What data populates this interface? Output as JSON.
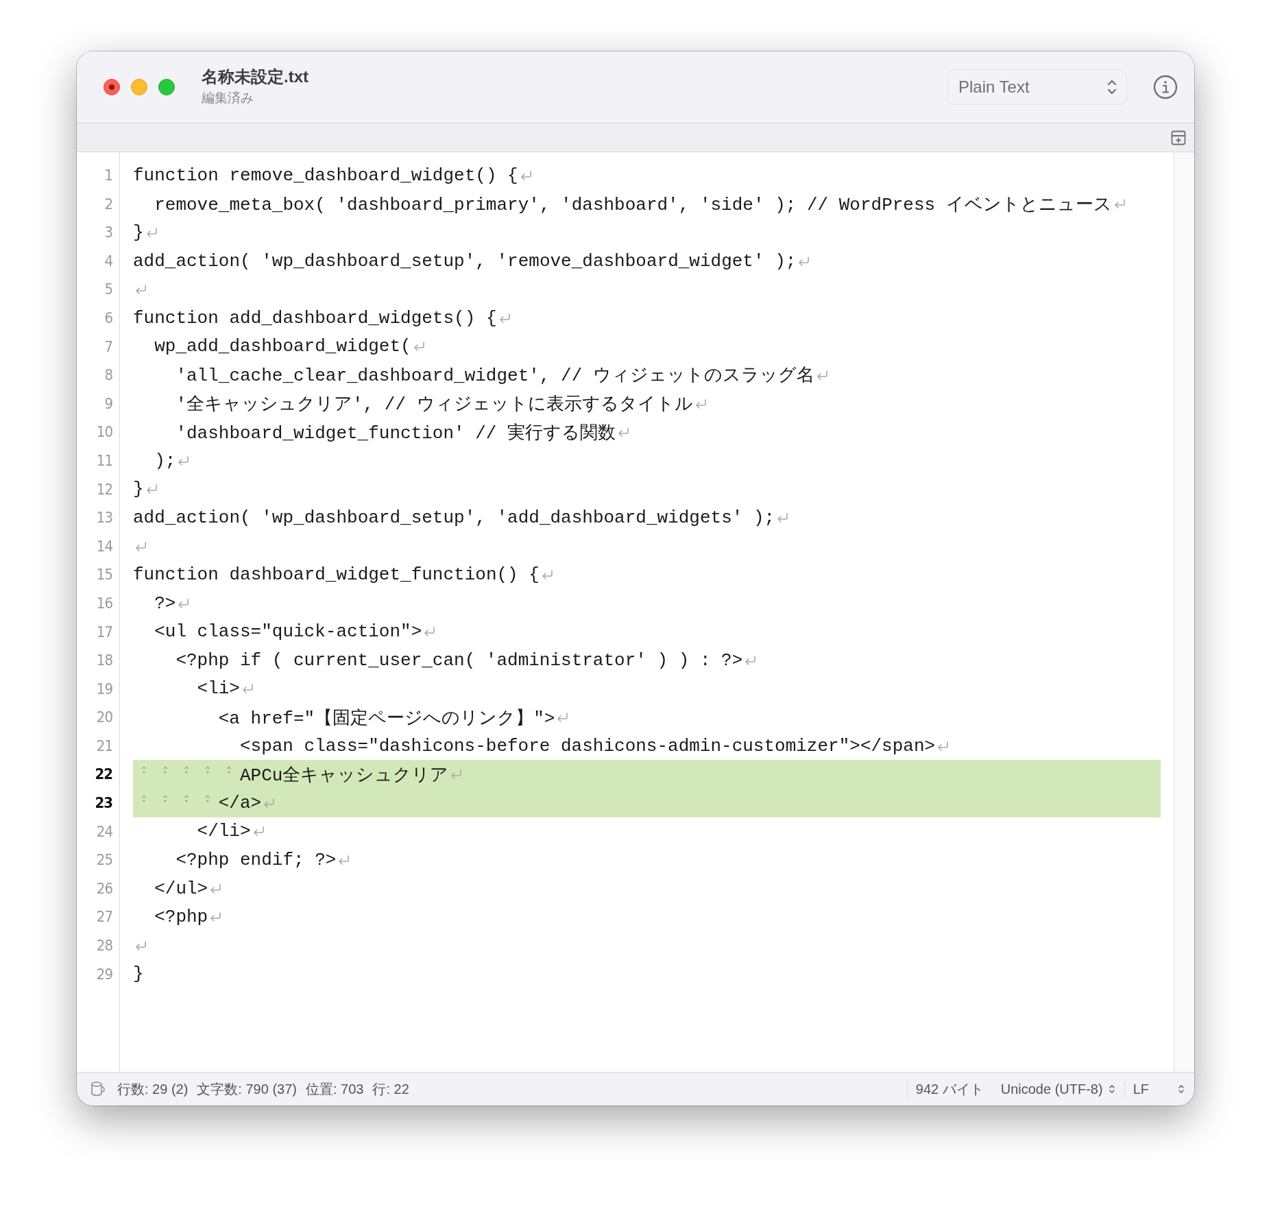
{
  "window": {
    "title": "名称未設定.txt",
    "subtitle": "編集済み"
  },
  "syntax_menu": {
    "value": "Plain Text"
  },
  "lines": [
    {
      "number": "1",
      "text": "function remove_dashboard_widget() {",
      "selected": false,
      "eol": true
    },
    {
      "number": "2",
      "text": "\tremove_meta_box( 'dashboard_primary', 'dashboard', 'side' ); // WordPress イベントとニュース",
      "selected": false,
      "eol": true
    },
    {
      "number": "3",
      "text": "}",
      "selected": false,
      "eol": true
    },
    {
      "number": "4",
      "text": "add_action( 'wp_dashboard_setup', 'remove_dashboard_widget' );",
      "selected": false,
      "eol": true
    },
    {
      "number": "5",
      "selected": false,
      "eol": true
    },
    {
      "number": "6",
      "text": "function add_dashboard_widgets() {",
      "selected": false,
      "eol": true
    },
    {
      "number": "7",
      "text": "\twp_add_dashboard_widget(",
      "selected": false,
      "eol": true
    },
    {
      "number": "8",
      "text": "\t\t'all_cache_clear_dashboard_widget', // ウィジェットのスラッグ名",
      "selected": false,
      "eol": true
    },
    {
      "number": "9",
      "text": "\t\t'全キャッシュクリア', // ウィジェットに表示するタイトル",
      "selected": false,
      "eol": true
    },
    {
      "number": "10",
      "text": "\t\t'dashboard_widget_function' // 実行する関数",
      "selected": false,
      "eol": true
    },
    {
      "number": "11",
      "text": "\t);",
      "selected": false,
      "eol": true
    },
    {
      "number": "12",
      "text": "}",
      "selected": false,
      "eol": true
    },
    {
      "number": "13",
      "text": "add_action( 'wp_dashboard_setup', 'add_dashboard_widgets' );",
      "selected": false,
      "eol": true
    },
    {
      "number": "14",
      "selected": false,
      "eol": true
    },
    {
      "number": "15",
      "text": "function dashboard_widget_function() {",
      "selected": false,
      "eol": true
    },
    {
      "number": "16",
      "text": "\t?>",
      "selected": false,
      "eol": true
    },
    {
      "number": "17",
      "text": "\t<ul class=\"quick-action\">",
      "selected": false,
      "eol": true
    },
    {
      "number": "18",
      "text": "\t\t<?php if ( current_user_can( 'administrator' ) ) : ?>",
      "selected": false,
      "eol": true
    },
    {
      "number": "19",
      "text": "\t\t\t<li>",
      "selected": false,
      "eol": true
    },
    {
      "number": "20",
      "text": "\t\t\t\t<a href=\"【固定ページへのリンク】\">",
      "selected": false,
      "eol": true
    },
    {
      "number": "21",
      "text": "\t\t\t\t\t<span class=\"dashicons-before dashicons-admin-customizer\"></span>",
      "selected": false,
      "eol": true
    },
    {
      "number": "22",
      "text": "\t\t\t\t\tAPCu全キャッシュクリア",
      "selected": true,
      "eol": true
    },
    {
      "number": "23",
      "text": "\t\t\t\t</a>",
      "selected": true,
      "eol": true
    },
    {
      "number": "24",
      "text": "\t\t\t</li>",
      "selected": false,
      "eol": true
    },
    {
      "number": "25",
      "text": "\t\t<?php endif; ?>",
      "selected": false,
      "eol": true
    },
    {
      "number": "26",
      "text": "\t</ul>",
      "selected": false,
      "eol": true
    },
    {
      "number": "27",
      "text": "\t<?php",
      "selected": false,
      "eol": true
    },
    {
      "number": "28",
      "selected": false,
      "eol": true
    },
    {
      "number": "29",
      "text": "}",
      "selected": false,
      "eol": false
    }
  ],
  "status_bar": {
    "left": [
      "行数: 29 (2)",
      "文字数: 790 (37)",
      "位置: 703",
      "行: 22"
    ],
    "right": [
      {
        "text": "942 バイト",
        "kind": "label"
      },
      {
        "text": "Unicode (UTF-8)",
        "kind": "popup"
      },
      {
        "text": "LF",
        "kind": "popup"
      }
    ]
  }
}
